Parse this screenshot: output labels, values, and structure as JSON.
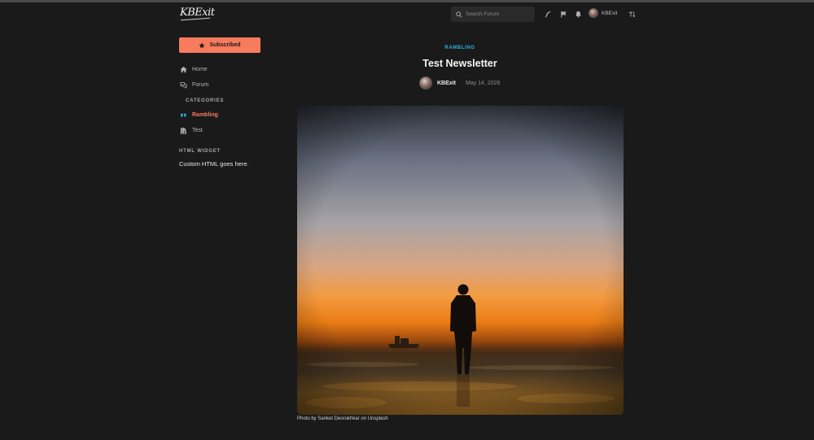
{
  "header": {
    "logo_text": "KBExit",
    "search_placeholder": "Search Forum",
    "icons": [
      "feather-icon",
      "flag-icon",
      "bell-icon",
      "sort-icon"
    ],
    "user_name": "KBExit"
  },
  "sidebar": {
    "subscribe_label": "Subscribed",
    "nav": [
      {
        "label": "Home",
        "icon": "home-icon"
      },
      {
        "label": "Forum",
        "icon": "forum-icon"
      }
    ],
    "categories_heading": "CATEGORIES",
    "categories": [
      {
        "label": "Rambling",
        "icon": "quote-icon",
        "active": true
      },
      {
        "label": "Test",
        "icon": "books-icon",
        "active": false
      }
    ],
    "widget_heading": "HTML WIDGET",
    "widget_text": "Custom HTML goes here."
  },
  "post": {
    "category": "RAMBLING",
    "title": "Test Newsletter",
    "author": "KBExit",
    "date": "May 14, 2026",
    "image_caption": "Photo by Sanket Deorukhkar on Unsplash"
  },
  "colors": {
    "background": "#1a1a1a",
    "accent": "#f87b5e",
    "category": "#2fb3e0"
  }
}
